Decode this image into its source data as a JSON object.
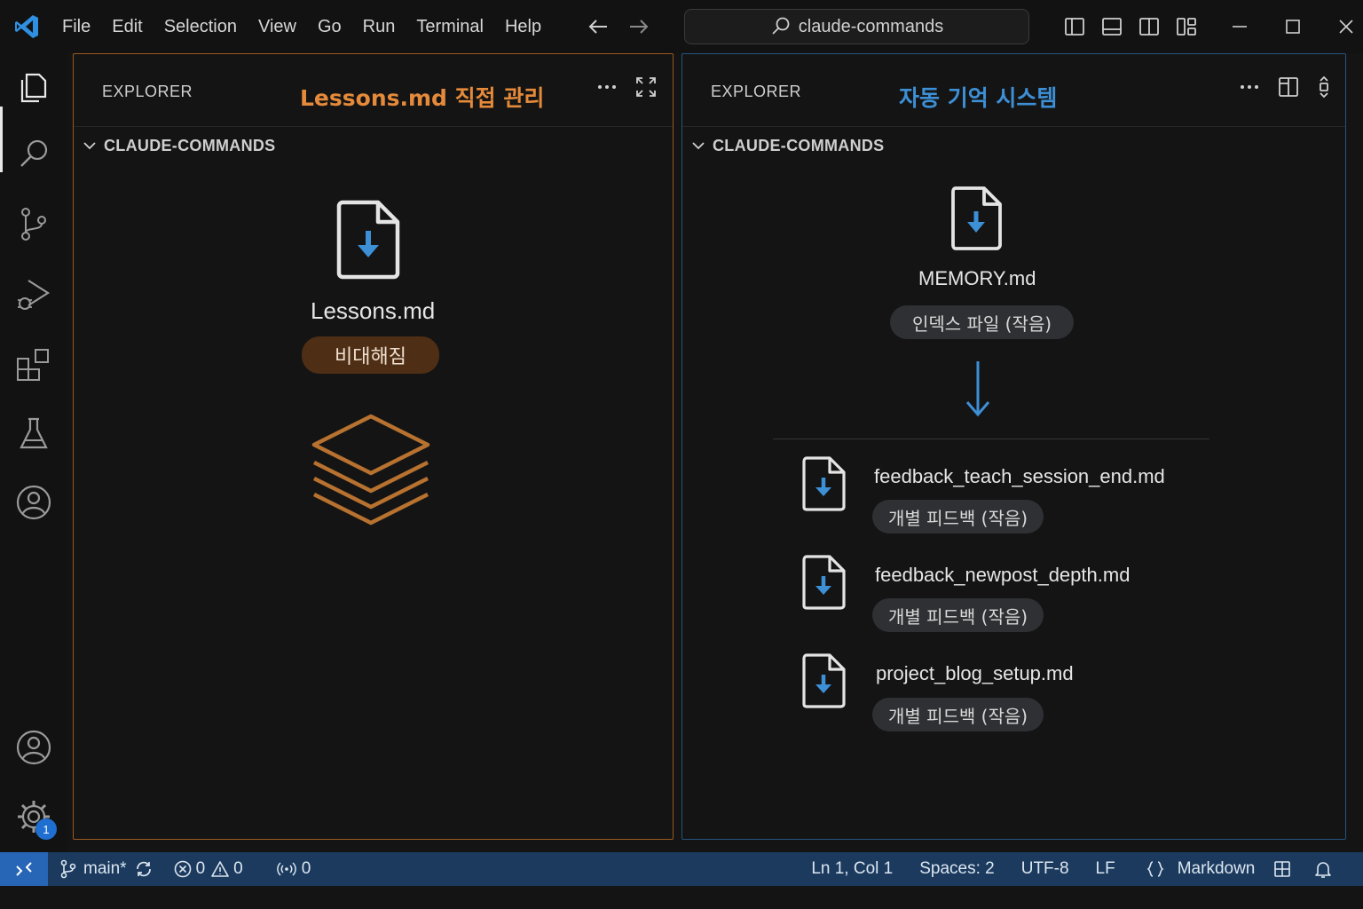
{
  "titlebar": {
    "menu": [
      "File",
      "Edit",
      "Selection",
      "View",
      "Go",
      "Run",
      "Terminal",
      "Help"
    ],
    "search_text": "claude-commands"
  },
  "activitybar": {
    "icons": [
      "explorer-icon",
      "search-icon",
      "source-control-icon",
      "run-debug-icon",
      "extensions-icon",
      "testing-icon",
      "accounts-icon"
    ],
    "bottom_icons": [
      "account-icon",
      "settings-gear-icon"
    ],
    "settings_badge": "1"
  },
  "left_panel": {
    "explorer_label": "EXPLORER",
    "heading": "Lessons.md 직접 관리",
    "section_label": "CLAUDE-COMMANDS",
    "file_name": "Lessons.md",
    "status_pill": "비대해짐",
    "accent": "#e58a3a"
  },
  "right_panel": {
    "explorer_label": "EXPLORER",
    "heading": "자동 기억 시스템",
    "section_label": "CLAUDE-COMMANDS",
    "index_file": {
      "name": "MEMORY.md",
      "pill": "인덱스 파일 (작음)"
    },
    "files": [
      {
        "name": "feedback_teach_session_end.md",
        "pill": "개별 피드백 (작음)"
      },
      {
        "name": "feedback_newpost_depth.md",
        "pill": "개별 피드백 (작음)"
      },
      {
        "name": "project_blog_setup.md",
        "pill": "개별 피드백 (작음)"
      }
    ],
    "accent": "#3d8fd6"
  },
  "statusbar": {
    "branch": "main*",
    "errors": "0",
    "warnings": "0",
    "ports": "0",
    "position": "Ln 1, Col 1",
    "spaces": "Spaces: 2",
    "encoding": "UTF-8",
    "eol": "LF",
    "language": "Markdown"
  }
}
